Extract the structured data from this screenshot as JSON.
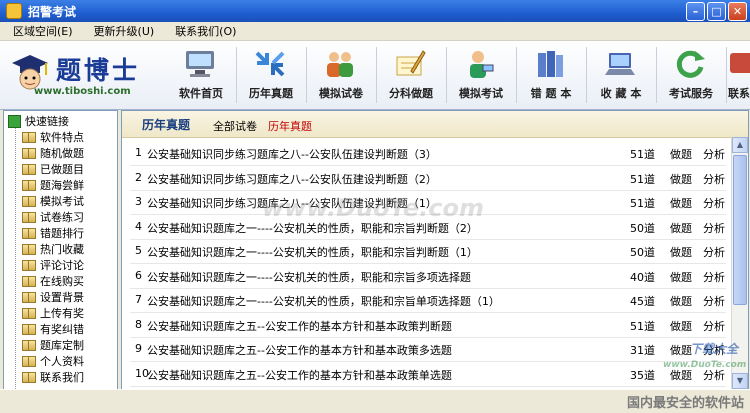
{
  "window": {
    "title": "招警考试"
  },
  "menu": [
    "区域空间(E)",
    "更新升级(U)",
    "联系我们(O)"
  ],
  "logo": {
    "text": "题博士",
    "url": "www.tiboshi.com"
  },
  "toolbar": {
    "buttons": [
      {
        "label": "软件首页",
        "icon": "computer-icon",
        "color": "#6b7f9a"
      },
      {
        "label": "历年真题",
        "icon": "arrows-icon",
        "color": "#3a86d8"
      },
      {
        "label": "模拟试卷",
        "icon": "users-icon",
        "color": "#d9692b"
      },
      {
        "label": "分科做题",
        "icon": "pen-paper-icon",
        "color": "#e0a640"
      },
      {
        "label": "模拟考试",
        "icon": "person-icon",
        "color": "#2b9b5a"
      },
      {
        "label": "错 题 本",
        "icon": "books-icon",
        "color": "#5a7ec9"
      },
      {
        "label": "收 藏 本",
        "icon": "laptop-icon",
        "color": "#4766b2"
      },
      {
        "label": "考试服务",
        "icon": "refresh-icon",
        "color": "#3da24a"
      },
      {
        "label": "联系",
        "icon": "contact-icon",
        "color": "#c84a3a"
      }
    ]
  },
  "sidebar": {
    "root": "快速链接",
    "items": [
      "软件特点",
      "随机做题",
      "已做题目",
      "题海尝鲜",
      "模拟考试",
      "试卷练习",
      "错题排行",
      "热门收藏",
      "评论讨论",
      "在线购买",
      "设置背景",
      "上传有奖",
      "有奖纠错",
      "题库定制",
      "个人资料",
      "联系我们"
    ]
  },
  "main": {
    "title": "历年真题",
    "link_all": "全部试卷",
    "link_current": "历年真题",
    "rows": [
      {
        "num": "1",
        "title": "公安基础知识同步练习题库之八--公安队伍建设判断题（3）",
        "count": "51道",
        "do": "做题",
        "analyze": "分析"
      },
      {
        "num": "2",
        "title": "公安基础知识同步练习题库之八--公安队伍建设判断题（2）",
        "count": "51道",
        "do": "做题",
        "analyze": "分析"
      },
      {
        "num": "3",
        "title": "公安基础知识同步练习题库之八--公安队伍建设判断题（1）",
        "count": "51道",
        "do": "做题",
        "analyze": "分析"
      },
      {
        "num": "4",
        "title": "公安基础知识题库之一----公安机关的性质，职能和宗旨判断题（2）",
        "count": "50道",
        "do": "做题",
        "analyze": "分析"
      },
      {
        "num": "5",
        "title": "公安基础知识题库之一----公安机关的性质，职能和宗旨判断题（1）",
        "count": "50道",
        "do": "做题",
        "analyze": "分析"
      },
      {
        "num": "6",
        "title": "公安基础知识题库之一----公安机关的性质，职能和宗旨多项选择题",
        "count": "40道",
        "do": "做题",
        "analyze": "分析"
      },
      {
        "num": "7",
        "title": "公安基础知识题库之一----公安机关的性质，职能和宗旨单项选择题（1）",
        "count": "45道",
        "do": "做题",
        "analyze": "分析"
      },
      {
        "num": "8",
        "title": "公安基础知识题库之五--公安工作的基本方针和基本政策判断题",
        "count": "51道",
        "do": "做题",
        "analyze": "分析"
      },
      {
        "num": "9",
        "title": "公安基础知识题库之五--公安工作的基本方针和基本政策多选题",
        "count": "31道",
        "do": "做题",
        "analyze": "分析"
      },
      {
        "num": "10",
        "title": "公安基础知识题库之五--公安工作的基本方针和基本政策单选题",
        "count": "35道",
        "do": "做题",
        "analyze": "分析"
      }
    ]
  },
  "watermarks": {
    "center": "www.DuoTe.com",
    "small_url": "www.DuoTe.com",
    "brand": "下载大全",
    "status": "国内最安全的软件站"
  }
}
